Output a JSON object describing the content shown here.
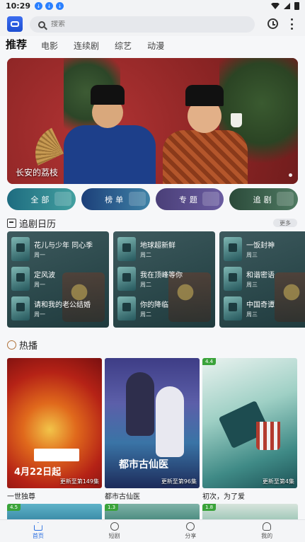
{
  "status": {
    "time": "10:29",
    "notif_icons": [
      "download-icon",
      "download-icon",
      "download-icon"
    ]
  },
  "search": {
    "placeholder": "搜索"
  },
  "tabs": [
    {
      "label": "推荐",
      "active": true
    },
    {
      "label": "电影",
      "active": false
    },
    {
      "label": "连续剧",
      "active": false
    },
    {
      "label": "综艺",
      "active": false
    },
    {
      "label": "动漫",
      "active": false
    }
  ],
  "banner": {
    "caption": "长安的荔枝"
  },
  "quick_buttons": [
    {
      "label": "全部"
    },
    {
      "label": "榜单"
    },
    {
      "label": "专题"
    },
    {
      "label": "追剧"
    }
  ],
  "calendar": {
    "title": "追剧日历",
    "more": "更多",
    "cards": [
      {
        "items": [
          {
            "name": "花儿与少年 同心季",
            "day": "周一"
          },
          {
            "name": "定风波",
            "day": "周一"
          },
          {
            "name": "请和我的老公结婚",
            "day": "周一"
          }
        ]
      },
      {
        "items": [
          {
            "name": "地球超新鲜",
            "day": "周二"
          },
          {
            "name": "我在顶峰等你",
            "day": "周二"
          },
          {
            "name": "你的降临",
            "day": "周二"
          }
        ]
      },
      {
        "items": [
          {
            "name": "一饭封神",
            "day": "周三"
          },
          {
            "name": "和谐密语",
            "day": "周三"
          },
          {
            "name": "中国奇谭",
            "day": "周三"
          }
        ]
      }
    ]
  },
  "hot": {
    "title": "热播",
    "posters": [
      {
        "title": "一世独尊",
        "episode": "更新至第149集",
        "score": "",
        "date_text": "4月22日起"
      },
      {
        "title": "都市古仙医",
        "episode": "更新至第96集",
        "score": "",
        "poster_text": "都市古仙医"
      },
      {
        "title": "初次，为了爱",
        "episode": "更新至第4集",
        "score": "4.4"
      }
    ],
    "next_row_scores": [
      "4.5",
      "1.3",
      "1.8"
    ]
  },
  "bottom_nav": [
    {
      "label": "首页",
      "active": true
    },
    {
      "label": "短剧",
      "active": false
    },
    {
      "label": "分享",
      "active": false
    },
    {
      "label": "我的",
      "active": false
    }
  ],
  "colors": {
    "accent": "#2b6fe0",
    "score_badge": "#3aa33a"
  }
}
